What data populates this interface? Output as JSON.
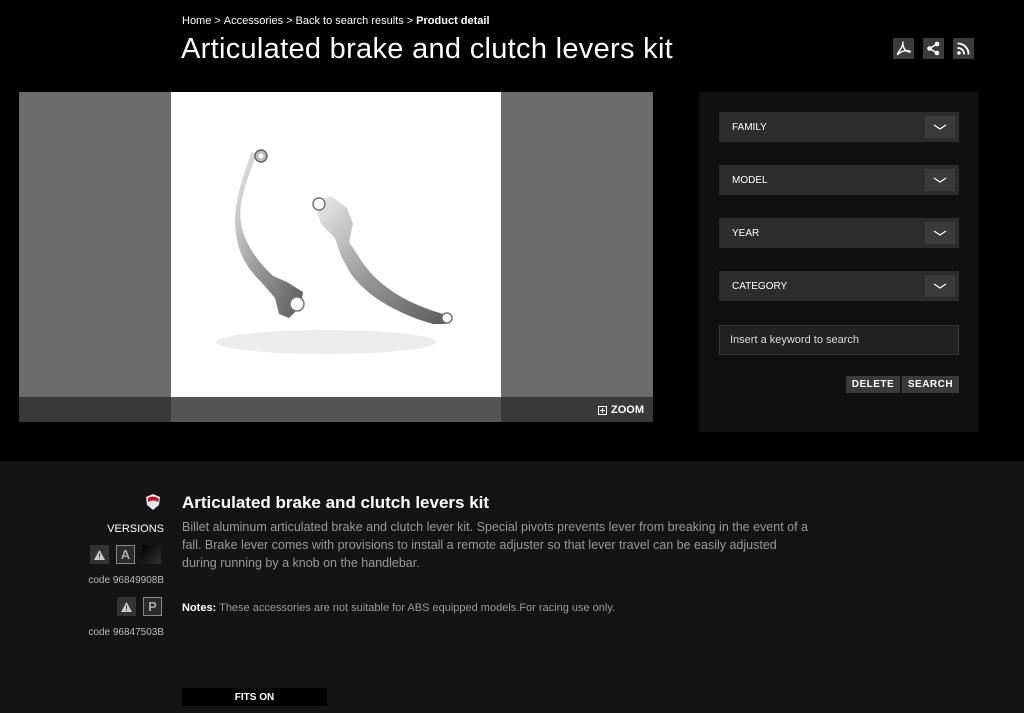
{
  "breadcrumb": {
    "home": "Home",
    "accessories": "Accessories",
    "back": "Back to search results",
    "current": "Product detail",
    "separator": ">"
  },
  "page_title": "Articulated brake and clutch levers kit",
  "tools": {
    "icons": [
      "pdf-icon",
      "share-icon",
      "rss-icon"
    ]
  },
  "gallery": {
    "zoom_label": "ZOOM"
  },
  "search": {
    "selects": [
      {
        "label": "FAMILY"
      },
      {
        "label": "MODEL"
      },
      {
        "label": "YEAR"
      },
      {
        "label": "CATEGORY"
      }
    ],
    "keyword_placeholder": "Insert a keyword to search",
    "delete_label": "DELETE",
    "search_label": "SEARCH"
  },
  "product": {
    "title": "Articulated brake and clutch levers kit",
    "description": "Billet aluminum articulated brake and clutch lever kit. Special pivots prevents lever from breaking in the event of a fall. Brake lever comes with provisions to install a remote adjuster so that lever travel can be easily adjusted during running by a knob on the handlebar.",
    "notes_label": "Notes:",
    "notes_text": "These accessories are not suitable for ABS equipped models.For racing use only.",
    "versions_label": "VERSIONS",
    "versions": [
      {
        "badge": "A",
        "code": "code 96849908B"
      },
      {
        "badge": "P",
        "code": "code 96847503B"
      }
    ],
    "fits_on_label": "FITS ON"
  },
  "colors": {
    "accent_red": "#c8102e",
    "panel": "#111111",
    "bottom_bg": "#141414"
  }
}
